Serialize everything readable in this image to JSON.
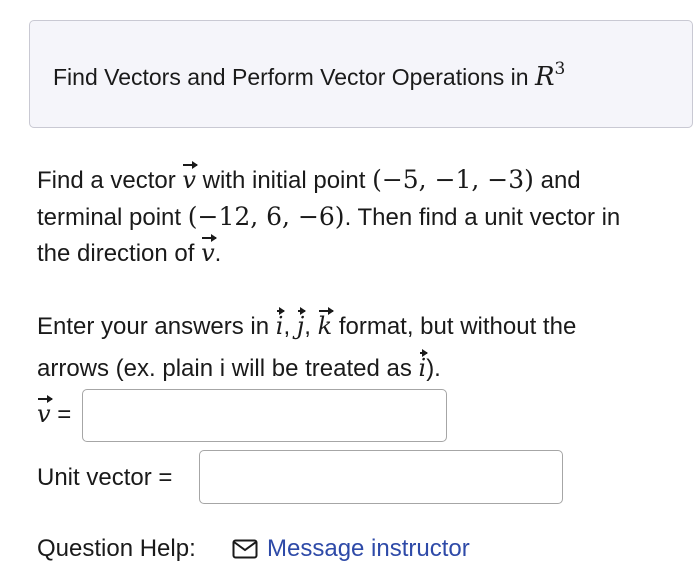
{
  "header": {
    "title": "Find Vectors and Perform Vector Operations in",
    "space": "R",
    "dimension": "3"
  },
  "problem": {
    "intro": "Find a vector",
    "vector_symbol": "v",
    "initial_label": "with initial point",
    "initial_point": "(−5, −1, −3)",
    "and_text": "and",
    "terminal_label": "terminal point",
    "terminal_point": "(−12, 6, −6)",
    "unit_text": ". Then find a unit vector in",
    "direction_text": "the direction of",
    "period": "."
  },
  "instructions": {
    "line1_start": "Enter your answers in",
    "i": "i",
    "j": "j",
    "k": "k",
    "line1_end": "format, but without the",
    "line2_start": "arrows (ex. plain i will be treated as",
    "line2_end": ")."
  },
  "answers": {
    "v_label": "=",
    "v_value": "",
    "unit_label": "Unit vector =",
    "unit_value": ""
  },
  "help": {
    "label": "Question Help:",
    "message_link": "Message instructor",
    "icon": "envelope-icon"
  },
  "colors": {
    "header_bg": "#f5f5fa",
    "header_border": "#c9c9d3",
    "link": "#2e4aa8",
    "input_border": "#a6a6a6"
  }
}
